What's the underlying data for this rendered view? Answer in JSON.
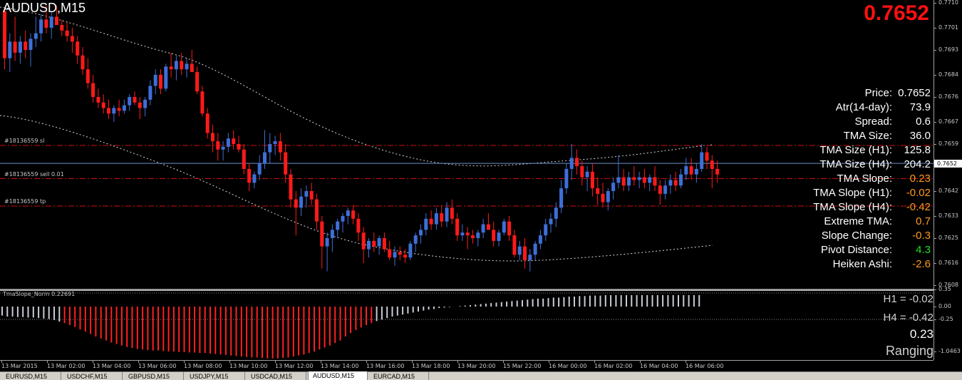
{
  "window": {
    "symbol_title": "AUDUSD,M15",
    "big_price": "0.7652"
  },
  "orders": [
    {
      "label": "#18136559 sl",
      "price": 0.76585
    },
    {
      "label": "#18136559 sell 0.01",
      "price": 0.76465
    },
    {
      "label": "#18136559 tp",
      "price": 0.76366
    }
  ],
  "current_price": {
    "value": 0.7652,
    "label": "0.7652"
  },
  "info_panel": [
    {
      "label": "Price:",
      "value": "0.7652",
      "color": "#ffffff"
    },
    {
      "label": "Atr(14-day):",
      "value": "73.9",
      "color": "#ffffff"
    },
    {
      "label": "Spread:",
      "value": "0.6",
      "color": "#ffffff"
    },
    {
      "label": "TMA Size:",
      "value": "36.0",
      "color": "#ffffff"
    },
    {
      "label": "TMA Size (H1):",
      "value": "125.8",
      "color": "#ffffff"
    },
    {
      "label": "TMA Size (H4):",
      "value": "204.2",
      "color": "#ffffff"
    },
    {
      "label": "TMA Slope:",
      "value": "0.23",
      "color": "#ff9a1e"
    },
    {
      "label": "TMA Slope (H1):",
      "value": "-0.02",
      "color": "#ff9a1e"
    },
    {
      "label": "TMA Slope (H4):",
      "value": "-0.42",
      "color": "#ff9a1e"
    },
    {
      "label": "Extreme TMA:",
      "value": "0.7",
      "color": "#ff9a1e"
    },
    {
      "label": "Slope Change:",
      "value": "-0.3",
      "color": "#ff9a1e"
    },
    {
      "label": "Pivot Distance:",
      "value": "4.3",
      "color": "#22dd22"
    },
    {
      "label": "Heiken Ashi:",
      "value": "-2.6",
      "color": "#ff9a1e"
    }
  ],
  "price_axis": {
    "ticks": [
      "0.7710",
      "0.7701",
      "0.7693",
      "0.7684",
      "0.7676",
      "0.7667",
      "0.7659",
      "0.7642",
      "0.7633",
      "0.7625",
      "0.7616",
      "0.7608"
    ],
    "tick_values": [
      0.771,
      0.7701,
      0.7693,
      0.7684,
      0.7676,
      0.7667,
      0.7659,
      0.7642,
      0.7633,
      0.7625,
      0.7616,
      0.7608
    ]
  },
  "subwindow": {
    "label": "TmaSlope_Norm 0.22691",
    "h1_text": "H1 = -0.02",
    "h4_text": "H4 = -0.42",
    "slope_value": "0.23",
    "state": "Ranging",
    "ticks": [
      "0.35",
      "0.00",
      "-0.25",
      "-1.0463"
    ],
    "tick_values": [
      0.35,
      0.0,
      -0.25,
      -1.0463
    ]
  },
  "time_axis": {
    "labels": [
      "13 Mar 2015",
      "13 Mar 02:00",
      "13 Mar 04:00",
      "13 Mar 06:00",
      "13 Mar 08:00",
      "13 Mar 10:00",
      "13 Mar 12:00",
      "13 Mar 14:00",
      "13 Mar 16:00",
      "13 Mar 18:00",
      "13 Mar 20:00",
      "15 Mar 22:00",
      "16 Mar 00:00",
      "16 Mar 02:00",
      "16 Mar 04:00",
      "16 Mar 06:00"
    ]
  },
  "tabs": [
    {
      "label": "EURUSD,M15",
      "active": false
    },
    {
      "label": "USDCHF,M15",
      "active": false
    },
    {
      "label": "GBPUSD,M15",
      "active": false
    },
    {
      "label": "USDJPY,M15",
      "active": false
    },
    {
      "label": "USDCAD,M15",
      "active": false
    },
    {
      "label": "AUDUSD,M15",
      "active": true
    },
    {
      "label": "EURCAD,M15",
      "active": false
    }
  ],
  "colors": {
    "bull": "#3e6fd8",
    "bear": "#ff1a1a",
    "order_line": "#d01010",
    "price_line": "#6f8fc8",
    "tma_band": "#d8d8d8",
    "slope_negative": "#ff2020",
    "slope_neutral": "#c8ccd4"
  },
  "candles": [
    [
      0.7707,
      0.7708,
      0.7686,
      0.769
    ],
    [
      0.769,
      0.7699,
      0.7685,
      0.7696
    ],
    [
      0.7696,
      0.7705,
      0.7689,
      0.7692
    ],
    [
      0.7692,
      0.7698,
      0.7688,
      0.7696
    ],
    [
      0.7696,
      0.77,
      0.769,
      0.7693
    ],
    [
      0.7693,
      0.7699,
      0.7687,
      0.7697
    ],
    [
      0.7697,
      0.7705,
      0.7694,
      0.7699
    ],
    [
      0.7699,
      0.7706,
      0.7696,
      0.7704
    ],
    [
      0.7704,
      0.7709,
      0.7699,
      0.7701
    ],
    [
      0.7701,
      0.7707,
      0.7697,
      0.7705
    ],
    [
      0.7705,
      0.7709,
      0.7702,
      0.7702
    ],
    [
      0.7702,
      0.7704,
      0.7698,
      0.77
    ],
    [
      0.77,
      0.7703,
      0.7696,
      0.7698
    ],
    [
      0.7698,
      0.7701,
      0.7692,
      0.7696
    ],
    [
      0.7696,
      0.7698,
      0.7688,
      0.7691
    ],
    [
      0.7691,
      0.7694,
      0.7684,
      0.7686
    ],
    [
      0.7686,
      0.769,
      0.7679,
      0.7681
    ],
    [
      0.7681,
      0.7684,
      0.7674,
      0.7676
    ],
    [
      0.7676,
      0.7679,
      0.7672,
      0.7674
    ],
    [
      0.7674,
      0.7677,
      0.767,
      0.7672
    ],
    [
      0.7672,
      0.7675,
      0.7668,
      0.767
    ],
    [
      0.767,
      0.7673,
      0.7667,
      0.7672
    ],
    [
      0.7672,
      0.7675,
      0.7669,
      0.7671
    ],
    [
      0.7671,
      0.7675,
      0.767,
      0.7673
    ],
    [
      0.7673,
      0.7677,
      0.7671,
      0.7676
    ],
    [
      0.7676,
      0.7678,
      0.7673,
      0.7674
    ],
    [
      0.7674,
      0.7676,
      0.7668,
      0.7672
    ],
    [
      0.7672,
      0.7676,
      0.7669,
      0.7675
    ],
    [
      0.7675,
      0.7682,
      0.7673,
      0.768
    ],
    [
      0.768,
      0.7686,
      0.7677,
      0.7684
    ],
    [
      0.7684,
      0.7686,
      0.7677,
      0.7679
    ],
    [
      0.7679,
      0.7688,
      0.7678,
      0.7687
    ],
    [
      0.7687,
      0.7692,
      0.7683,
      0.7686
    ],
    [
      0.7686,
      0.7691,
      0.7682,
      0.7689
    ],
    [
      0.7689,
      0.7692,
      0.7684,
      0.7686
    ],
    [
      0.7686,
      0.769,
      0.7683,
      0.7688
    ],
    [
      0.7688,
      0.7693,
      0.7686,
      0.7685
    ],
    [
      0.7685,
      0.7687,
      0.7677,
      0.7678
    ],
    [
      0.7678,
      0.768,
      0.7669,
      0.767
    ],
    [
      0.767,
      0.7672,
      0.7661,
      0.7663
    ],
    [
      0.7663,
      0.7666,
      0.7656,
      0.766
    ],
    [
      0.766,
      0.7663,
      0.7653,
      0.7657
    ],
    [
      0.7657,
      0.766,
      0.7653,
      0.7658
    ],
    [
      0.7658,
      0.7663,
      0.7656,
      0.7661
    ],
    [
      0.7661,
      0.7664,
      0.7657,
      0.7659
    ],
    [
      0.7659,
      0.7662,
      0.7656,
      0.7657
    ],
    [
      0.7657,
      0.7659,
      0.7648,
      0.765
    ],
    [
      0.765,
      0.7652,
      0.7642,
      0.7645
    ],
    [
      0.7645,
      0.7649,
      0.7643,
      0.7648
    ],
    [
      0.7648,
      0.7655,
      0.7646,
      0.7652
    ],
    [
      0.7652,
      0.7664,
      0.765,
      0.7656
    ],
    [
      0.7656,
      0.7663,
      0.7652,
      0.7659
    ],
    [
      0.7659,
      0.7662,
      0.7655,
      0.766
    ],
    [
      0.766,
      0.7663,
      0.7653,
      0.7656
    ],
    [
      0.7656,
      0.7659,
      0.7645,
      0.7648
    ],
    [
      0.7648,
      0.765,
      0.7636,
      0.7639
    ],
    [
      0.7639,
      0.7642,
      0.7626,
      0.7636
    ],
    [
      0.7636,
      0.7643,
      0.7633,
      0.764
    ],
    [
      0.764,
      0.7644,
      0.7636,
      0.7642
    ],
    [
      0.7642,
      0.7645,
      0.7637,
      0.7639
    ],
    [
      0.7639,
      0.7641,
      0.7628,
      0.7631
    ],
    [
      0.7631,
      0.7633,
      0.7614,
      0.7622
    ],
    [
      0.7622,
      0.7627,
      0.7613,
      0.7625
    ],
    [
      0.7625,
      0.763,
      0.762,
      0.7628
    ],
    [
      0.7628,
      0.7632,
      0.7625,
      0.7631
    ],
    [
      0.7631,
      0.7634,
      0.7627,
      0.7633
    ],
    [
      0.7633,
      0.7636,
      0.763,
      0.7635
    ],
    [
      0.7635,
      0.7637,
      0.763,
      0.7632
    ],
    [
      0.7632,
      0.7634,
      0.7624,
      0.7627
    ],
    [
      0.7627,
      0.7629,
      0.7616,
      0.7621
    ],
    [
      0.7621,
      0.7625,
      0.7618,
      0.7624
    ],
    [
      0.7624,
      0.7627,
      0.762,
      0.7622
    ],
    [
      0.7622,
      0.7626,
      0.7619,
      0.7625
    ],
    [
      0.7625,
      0.7627,
      0.762,
      0.7621
    ],
    [
      0.7621,
      0.7624,
      0.7617,
      0.7618
    ],
    [
      0.7618,
      0.7622,
      0.7615,
      0.762
    ],
    [
      0.762,
      0.7622,
      0.7617,
      0.7619
    ],
    [
      0.7619,
      0.7621,
      0.7616,
      0.7618
    ],
    [
      0.7618,
      0.7624,
      0.7617,
      0.7623
    ],
    [
      0.7623,
      0.7627,
      0.762,
      0.7626
    ],
    [
      0.7626,
      0.763,
      0.7623,
      0.7628
    ],
    [
      0.7628,
      0.7634,
      0.7626,
      0.7632
    ],
    [
      0.7632,
      0.7635,
      0.7628,
      0.763
    ],
    [
      0.763,
      0.7636,
      0.7628,
      0.7634
    ],
    [
      0.7634,
      0.7637,
      0.7629,
      0.7631
    ],
    [
      0.7631,
      0.7638,
      0.7629,
      0.7636
    ],
    [
      0.7636,
      0.7639,
      0.763,
      0.7632
    ],
    [
      0.7632,
      0.7634,
      0.7624,
      0.7626
    ],
    [
      0.7626,
      0.763,
      0.7624,
      0.7627
    ],
    [
      0.7627,
      0.7629,
      0.7621,
      0.7626
    ],
    [
      0.7626,
      0.7628,
      0.7623,
      0.7625
    ],
    [
      0.7625,
      0.7628,
      0.7622,
      0.7627
    ],
    [
      0.7627,
      0.7632,
      0.7625,
      0.763
    ],
    [
      0.763,
      0.7634,
      0.7628,
      0.7628
    ],
    [
      0.7628,
      0.7631,
      0.7622,
      0.7624
    ],
    [
      0.7624,
      0.7628,
      0.7622,
      0.7627
    ],
    [
      0.7627,
      0.7632,
      0.7626,
      0.7631
    ],
    [
      0.7631,
      0.7633,
      0.7624,
      0.7626
    ],
    [
      0.7626,
      0.7628,
      0.7618,
      0.7619
    ],
    [
      0.7619,
      0.7624,
      0.7617,
      0.7622
    ],
    [
      0.7622,
      0.7625,
      0.7614,
      0.7617
    ],
    [
      0.7617,
      0.7621,
      0.7613,
      0.7619
    ],
    [
      0.7619,
      0.7624,
      0.7617,
      0.7623
    ],
    [
      0.7623,
      0.7628,
      0.7621,
      0.7626
    ],
    [
      0.7626,
      0.7632,
      0.7624,
      0.763
    ],
    [
      0.763,
      0.7634,
      0.7627,
      0.7632
    ],
    [
      0.7632,
      0.7638,
      0.7629,
      0.7636
    ],
    [
      0.7636,
      0.7646,
      0.7634,
      0.7643
    ],
    [
      0.7643,
      0.7652,
      0.7641,
      0.765
    ],
    [
      0.765,
      0.7659,
      0.7646,
      0.7654
    ],
    [
      0.7654,
      0.7657,
      0.7648,
      0.7651
    ],
    [
      0.7651,
      0.7653,
      0.7644,
      0.7647
    ],
    [
      0.7647,
      0.7651,
      0.7642,
      0.7649
    ],
    [
      0.7649,
      0.7652,
      0.764,
      0.7643
    ],
    [
      0.7643,
      0.7647,
      0.7637,
      0.7641
    ],
    [
      0.7641,
      0.7645,
      0.7636,
      0.7638
    ],
    [
      0.7638,
      0.7643,
      0.7635,
      0.7642
    ],
    [
      0.7642,
      0.7647,
      0.7639,
      0.7645
    ],
    [
      0.7645,
      0.7655,
      0.7643,
      0.7647
    ],
    [
      0.7647,
      0.765,
      0.7642,
      0.7644
    ],
    [
      0.7644,
      0.7649,
      0.7642,
      0.7647
    ],
    [
      0.7647,
      0.7651,
      0.7644,
      0.7646
    ],
    [
      0.7646,
      0.7649,
      0.7643,
      0.7647
    ],
    [
      0.7647,
      0.765,
      0.7643,
      0.7645
    ],
    [
      0.7645,
      0.7648,
      0.7642,
      0.7647
    ],
    [
      0.7647,
      0.7651,
      0.7642,
      0.7644
    ],
    [
      0.7644,
      0.7646,
      0.7637,
      0.7641
    ],
    [
      0.7641,
      0.7646,
      0.7639,
      0.7644
    ],
    [
      0.7644,
      0.7648,
      0.7641,
      0.7646
    ],
    [
      0.7646,
      0.7649,
      0.7642,
      0.7644
    ],
    [
      0.7644,
      0.765,
      0.7643,
      0.7648
    ],
    [
      0.7648,
      0.7654,
      0.7646,
      0.7651
    ],
    [
      0.7651,
      0.7654,
      0.7646,
      0.7648
    ],
    [
      0.7648,
      0.7652,
      0.7645,
      0.765
    ],
    [
      0.765,
      0.7659,
      0.7649,
      0.7656
    ],
    [
      0.7656,
      0.7658,
      0.765,
      0.7653
    ],
    [
      0.7653,
      0.7655,
      0.7643,
      0.765
    ],
    [
      0.765,
      0.7653,
      0.7645,
      0.7648
    ]
  ],
  "slope_bars": [
    -0.18,
    -0.2,
    -0.2,
    -0.21,
    -0.21,
    -0.22,
    -0.22,
    -0.23,
    -0.24,
    -0.25,
    -0.27,
    -0.3,
    -0.33,
    -0.37,
    -0.41,
    -0.46,
    -0.5,
    -0.55,
    -0.6,
    -0.64,
    -0.68,
    -0.72,
    -0.75,
    -0.78,
    -0.81,
    -0.83,
    -0.85,
    -0.86,
    -0.87,
    -0.88,
    -0.88,
    -0.89,
    -0.9,
    -0.9,
    -0.91,
    -0.91,
    -0.92,
    -0.92,
    -0.93,
    -0.93,
    -0.94,
    -0.95,
    -0.96,
    -0.97,
    -0.98,
    -0.99,
    -1.0,
    -1.01,
    -1.02,
    -1.02,
    -1.03,
    -1.04,
    -1.04,
    -1.04,
    -1.03,
    -1.02,
    -1.0,
    -0.98,
    -0.96,
    -0.93,
    -0.9,
    -0.86,
    -0.82,
    -0.78,
    -0.73,
    -0.68,
    -0.6,
    -0.53,
    -0.47,
    -0.42,
    -0.37,
    -0.33,
    -0.29,
    -0.26,
    -0.23,
    -0.2,
    -0.18,
    -0.16,
    -0.14,
    -0.12,
    -0.1,
    -0.08,
    -0.06,
    -0.05,
    -0.03,
    -0.02,
    -0.01,
    0.0,
    0.01,
    0.02,
    0.03,
    0.04,
    0.05,
    0.06,
    0.07,
    0.08,
    0.09,
    0.1,
    0.11,
    0.12,
    0.13,
    0.14,
    0.15,
    0.16,
    0.16,
    0.17,
    0.18,
    0.18,
    0.19,
    0.2,
    0.2,
    0.21,
    0.21,
    0.22,
    0.22,
    0.22,
    0.23,
    0.23,
    0.23,
    0.23,
    0.23,
    0.23,
    0.23,
    0.23,
    0.23,
    0.23,
    0.23,
    0.23,
    0.23,
    0.23,
    0.23,
    0.23,
    0.23,
    0.23,
    0.23
  ]
}
